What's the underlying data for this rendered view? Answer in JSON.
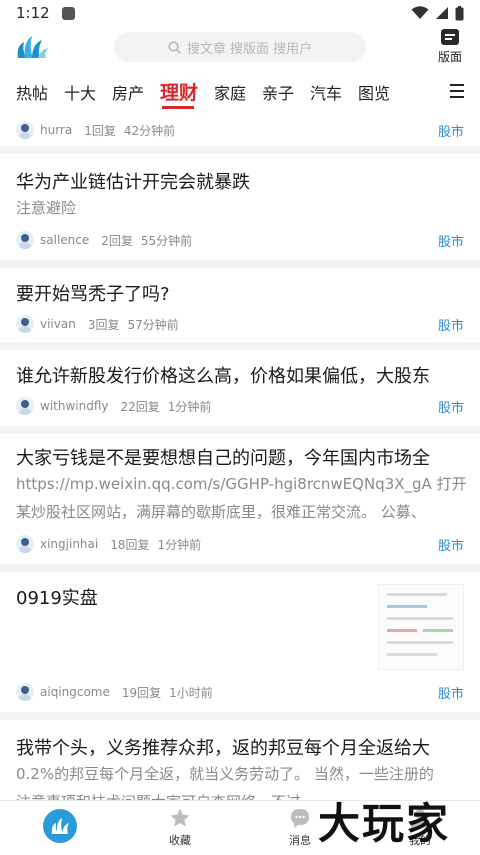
{
  "status": {
    "time": "1:12"
  },
  "search": {
    "placeholder": "搜文章 搜版面 搜用户"
  },
  "header": {
    "board_label": "版面"
  },
  "tabs": [
    "热帖",
    "十大",
    "房产",
    "理财",
    "家庭",
    "亲子",
    "汽车",
    "图览"
  ],
  "active_tab": "理财",
  "posts": [
    {
      "title": "",
      "body": "",
      "user": "hurra",
      "replies": "1回复",
      "time": "42分钟前",
      "category": "股市"
    },
    {
      "title": "华为产业链估计开完会就暴跌",
      "body": "注意避险",
      "user": "sallence",
      "replies": "2回复",
      "time": "55分钟前",
      "category": "股市"
    },
    {
      "title": "要开始骂秃子了吗?",
      "body": "",
      "user": "viivan",
      "replies": "3回复",
      "time": "57分钟前",
      "category": "股市"
    },
    {
      "title": "谁允许新股发行价格这么高，价格如果偏低，大股东",
      "body": "",
      "user": "withwindfly",
      "replies": "22回复",
      "time": "1分钟前",
      "category": "股市"
    },
    {
      "title": "大家亏钱是不是要想想自己的问题，今年国内市场全",
      "body_line1": "https://mp.weixin.qq.com/s/GGHP-hgi8rcnwEQNq3X_gA 打开",
      "body_line2": "某炒股社区网站，满屏幕的歇斯底里，很难正常交流。 公募、",
      "user": "xingjinhai",
      "replies": "18回复",
      "time": "1分钟前",
      "category": "股市"
    },
    {
      "title": "0919实盘",
      "body": "",
      "user": "aiqingcome",
      "replies": "19回复",
      "time": "1小时前",
      "category": "股市"
    },
    {
      "title": "我带个头，义务推荐众邦，返的邦豆每个月全返给大",
      "body_line1": "0.2%的邦豆每个月全返，就当义务劳动了。 当然，一些注册的",
      "body_line2": "注意事项和技术问题大家可自查网络，不过",
      "user": "",
      "replies": "",
      "time": "",
      "category": ""
    }
  ],
  "bottom_nav": {
    "home": "",
    "favorites": "收藏",
    "messages": "消息",
    "mine": "我的"
  },
  "watermark": "大玩家",
  "colors": {
    "accent": "#d7262c",
    "link": "#2a8ccf",
    "brand": "#2a9bd8"
  }
}
